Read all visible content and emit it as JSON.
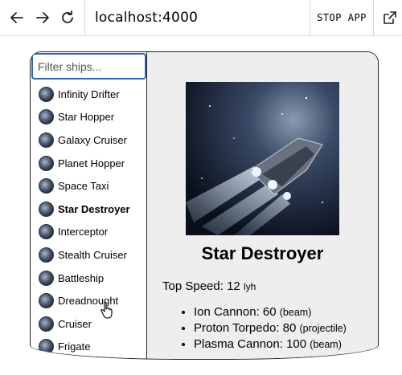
{
  "browser": {
    "url": "localhost:4000",
    "stop_label": "STOP APP",
    "icons": [
      "back-arrow-icon",
      "forward-arrow-icon",
      "reload-icon",
      "open-external-icon"
    ]
  },
  "sidebar": {
    "filter_placeholder": "Filter ships...",
    "ships": [
      {
        "name": "Infinity Drifter"
      },
      {
        "name": "Star Hopper"
      },
      {
        "name": "Galaxy Cruiser"
      },
      {
        "name": "Planet Hopper"
      },
      {
        "name": "Space Taxi"
      },
      {
        "name": "Star Destroyer",
        "selected": true
      },
      {
        "name": "Interceptor"
      },
      {
        "name": "Stealth Cruiser"
      },
      {
        "name": "Battleship"
      },
      {
        "name": "Dreadnought"
      },
      {
        "name": "Cruiser"
      },
      {
        "name": "Frigate"
      }
    ]
  },
  "detail": {
    "name": "Star Destroyer",
    "speed_label": "Top Speed:",
    "speed_value": "12",
    "speed_unit": "lyh",
    "weapons": [
      {
        "name": "Ion Cannon:",
        "power": "60",
        "type": "(beam)"
      },
      {
        "name": "Proton Torpedo:",
        "power": "80",
        "type": "(projectile)"
      },
      {
        "name": "Plasma Cannon:",
        "power": "100",
        "type": "(beam)"
      }
    ]
  },
  "colors": {
    "focus": "#2f62c8",
    "detail_bg": "#efeeef"
  }
}
